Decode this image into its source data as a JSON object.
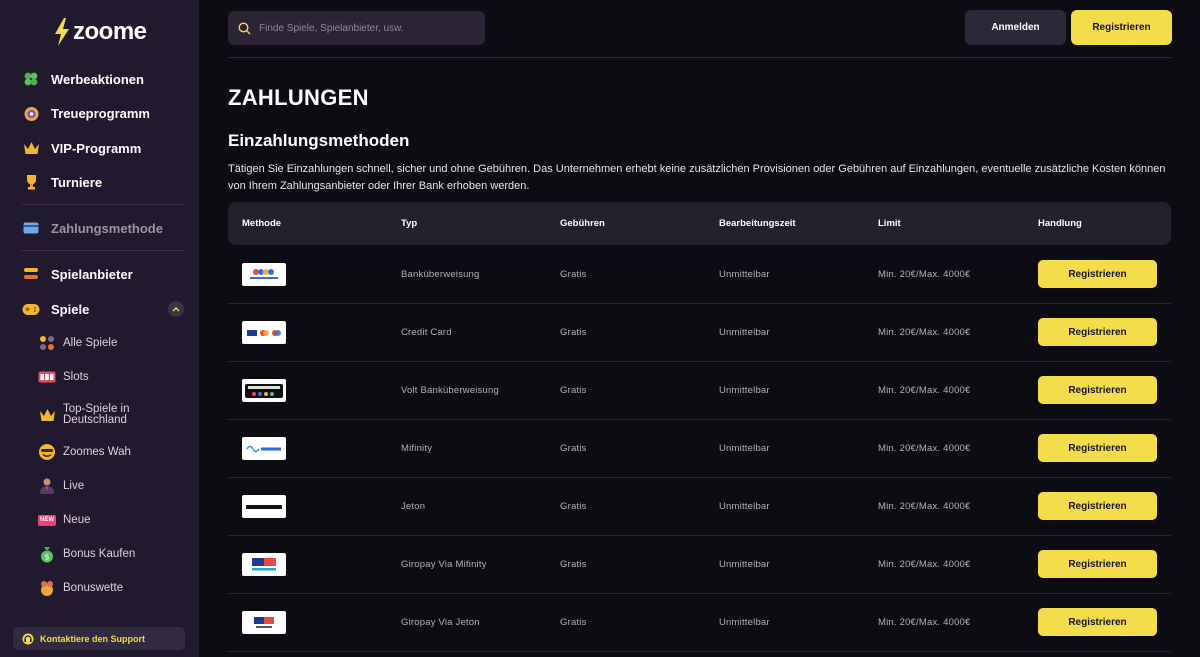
{
  "brand": {
    "name": "zoome",
    "accent": "#f4dd4a"
  },
  "sidebar": {
    "main": [
      {
        "label": "Werbeaktionen",
        "icon": "clover-icon"
      },
      {
        "label": "Treueprogramm",
        "icon": "treasure-icon"
      },
      {
        "label": "VIP-Programm",
        "icon": "crown-icon"
      },
      {
        "label": "Turniere",
        "icon": "trophy-icon"
      }
    ],
    "active": {
      "label": "Zahlungsmethode",
      "icon": "card-icon"
    },
    "providers": {
      "label": "Spielanbieter",
      "icon": "providers-icon"
    },
    "games": {
      "label": "Spiele",
      "icon": "gamepad-icon"
    },
    "games_sub": [
      {
        "label": "Alle Spiele",
        "icon": "grid-icon"
      },
      {
        "label": "Slots",
        "icon": "slot-icon"
      },
      {
        "label": "Top-Spiele in Deutschland",
        "icon": "crown-icon"
      },
      {
        "label": "Zoomes Wah",
        "icon": "smiley-icon"
      },
      {
        "label": "Live",
        "icon": "dealer-icon"
      },
      {
        "label": "Neue",
        "icon": "new-badge-icon",
        "badge": "NEW"
      },
      {
        "label": "Bonus Kaufen",
        "icon": "money-bag-icon"
      },
      {
        "label": "Bonuswette",
        "icon": "gift-icon"
      }
    ],
    "support": "Kontaktiere den Support"
  },
  "header": {
    "search_placeholder": "Finde Spiele, Spielanbieter, usw.",
    "login": "Anmelden",
    "register": "Registrieren"
  },
  "page": {
    "title": "ZAHLUNGEN",
    "section": "Einzahlungsmethoden",
    "description": "Tätigen Sie Einzahlungen schnell, sicher und ohne Gebühren. Das Unternehmen erhebt keine zusätzlichen Provisionen oder Gebühren auf Einzahlungen, eventuelle zusätzliche Kosten können von Ihrem Zahlungsanbieter oder Ihrer Bank erhoben werden."
  },
  "table": {
    "columns": [
      "Methode",
      "Typ",
      "Gebühren",
      "Bearbeitungszeit",
      "Limit",
      "Handlung"
    ],
    "rows": [
      {
        "logo": "bank-transfer-logo",
        "type": "Banküberweisung",
        "fee": "Gratis",
        "time": "Unmittelbar",
        "limit": "Min. 20€/Max. 4000€",
        "action": "Registrieren"
      },
      {
        "logo": "visa-mastercard-logo",
        "type": "Credit Card",
        "fee": "Gratis",
        "time": "Unmittelbar",
        "limit": "Min. 20€/Max. 4000€",
        "action": "Registrieren"
      },
      {
        "logo": "volt-logo",
        "type": "Volt Banküberweisung",
        "fee": "Gratis",
        "time": "Unmittelbar",
        "limit": "Min. 20€/Max. 4000€",
        "action": "Registrieren"
      },
      {
        "logo": "mifinity-logo",
        "type": "Mifinity",
        "fee": "Gratis",
        "time": "Unmittelbar",
        "limit": "Min. 20€/Max. 4000€",
        "action": "Registrieren"
      },
      {
        "logo": "jetonbank-logo",
        "type": "Jeton",
        "fee": "Gratis",
        "time": "Unmittelbar",
        "limit": "Min. 20€/Max. 4000€",
        "action": "Registrieren"
      },
      {
        "logo": "giropay-mifinity-logo",
        "type": "Giropay Via Mifinity",
        "fee": "Gratis",
        "time": "Unmittelbar",
        "limit": "Min. 20€/Max. 4000€",
        "action": "Registrieren"
      },
      {
        "logo": "giropay-jeton-logo",
        "type": "Giropay Via Jeton",
        "fee": "Gratis",
        "time": "Unmittelbar",
        "limit": "Min. 20€/Max. 4000€",
        "action": "Registrieren"
      }
    ]
  }
}
